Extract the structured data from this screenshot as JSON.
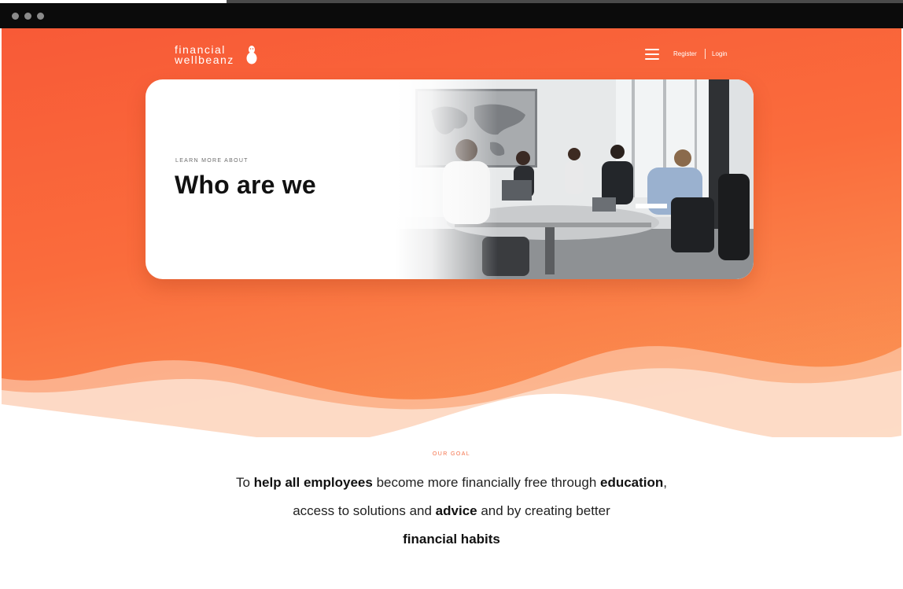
{
  "window": {
    "controls": [
      "close",
      "minimize",
      "maximize"
    ]
  },
  "header": {
    "logo": {
      "line1": "financial",
      "line2": "wellbeanz"
    },
    "nav": {
      "register": "Register",
      "login": "Login"
    },
    "icons": {
      "menu": "hamburger-menu-icon"
    }
  },
  "hero": {
    "eyebrow": "LEARN MORE ABOUT",
    "title": "Who are we",
    "image": "office-meeting-photo"
  },
  "goal": {
    "label": "OUR GOAL",
    "text": {
      "p1": "To ",
      "b1": "help all employees",
      "p2": " become more financially free through ",
      "b2": "education",
      "p3": ", access to solutions and ",
      "b3": "advice",
      "p4": " and by creating better ",
      "b4": "financial habits"
    }
  },
  "colors": {
    "accent": "#f85a37",
    "accent_light": "#fb9a58",
    "text": "#111111",
    "goal_label": "#f4724b"
  }
}
